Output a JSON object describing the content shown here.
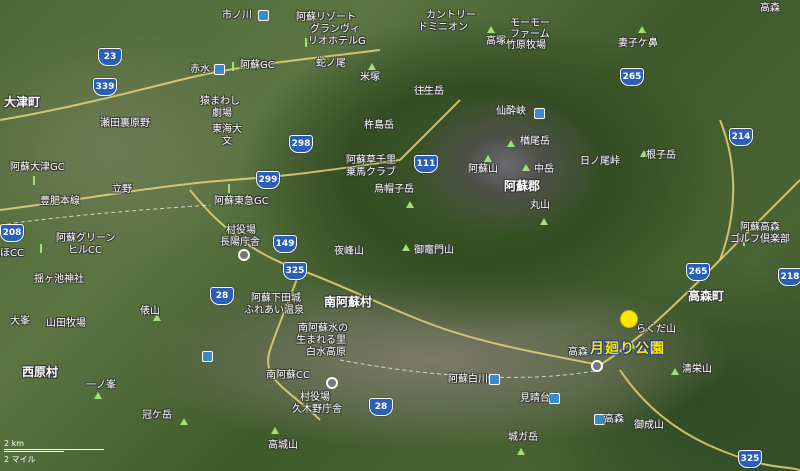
{
  "roads": [
    "23",
    "339",
    "298",
    "299",
    "208",
    "111",
    "149",
    "325",
    "28",
    "28",
    "265",
    "214",
    "265",
    "218",
    "325"
  ],
  "labels": {
    "ichinokawa": "市ノ川",
    "aso_resort": "阿蘇リゾート",
    "grandvrio1": "グランヴィ",
    "grandvrio2": "リオホテルG",
    "country1": "カントリー",
    "country2": "ドミニオン",
    "moomoo1": "モーモー",
    "moomoo2": "ファーム",
    "moomoo3": "竹原牧場",
    "takaba": "高塚",
    "tsumakogahana": "妻子ケ鼻",
    "takamori_top": "高森",
    "hebinoo": "蛇ノ尾",
    "akamizu": "赤水",
    "aso_gc": "阿蘇GC",
    "kometsuka": "米塚",
    "ojodake": "往生岳",
    "ozu": "大津町",
    "semawashi1": "猿まわし",
    "semawashi2": "劇場",
    "tokai": "東海大",
    "bun": "文",
    "setahigashi": "瀬田裏原野",
    "kishimadake": "杵島岳",
    "senshukyo": "仙酔峡",
    "takadake": "楢尾岳",
    "nakadake": "中岳",
    "asosan": "阿蘇山",
    "asogun": "阿蘇郡",
    "hinoodake": "日ノ尾峠",
    "nekodake": "根子岳",
    "kusasenri1": "阿蘇草千里",
    "kusasenri2": "乗馬クラブ",
    "eboshi": "烏帽子岳",
    "maruyama": "丸山",
    "aso_ozu_gc": "阿蘇大津GC",
    "tateno": "立野",
    "hohi": "豊肥本線",
    "aso_toukyu": "阿蘇東急GC",
    "aso_green1": "阿蘇グリーン",
    "aso_green2": "ヒルCC",
    "sonooyama": "夜峰山",
    "gokamado": "御竈門山",
    "village1": "村役場",
    "village2": "長陽庁舎",
    "asotakamori1": "阿蘇高森",
    "asotakamori2": "ゴルフ倶楽部",
    "cc": "ほCC",
    "uguike": "揺ヶ池神社",
    "minamiaso": "南阿蘇村",
    "takamori": "高森町",
    "asoshimoda1": "阿蘇下田城",
    "asoshimoda2": "ふれあい温泉",
    "tawarayama": "俵山",
    "rakudayama": "らくだ山",
    "yamada": "山田牧場",
    "ozumi": "大峯",
    "minamiaso_water1": "南阿蘇水の",
    "minamiaso_water2": "生まれる里",
    "minamiaso_water3": "白水高原",
    "park": "月廻り公園",
    "takamori_st": "高森",
    "seieizan": "清栄山",
    "nishihara": "西原村",
    "ichinomine": "一ノ峯",
    "minamiaso_cc": "南阿蘇CC",
    "village3": "村役場",
    "village4": "久木野庁舎",
    "asoshirakawa": "阿蘇白川",
    "mihara": "見晴台",
    "kanmuri": "冠ケ岳",
    "takamori2": "高森",
    "gosei": "御成山",
    "takashiro": "高城山",
    "shirogadake": "城ガ岳",
    "scale_km": "2 km",
    "scale_mi": "2 マイル"
  },
  "colors": {
    "road_shield": "#2a5fb8",
    "park_marker": "#ffe600",
    "park_label_outline": "#1d3a9a",
    "peak": "#9fe07a"
  }
}
